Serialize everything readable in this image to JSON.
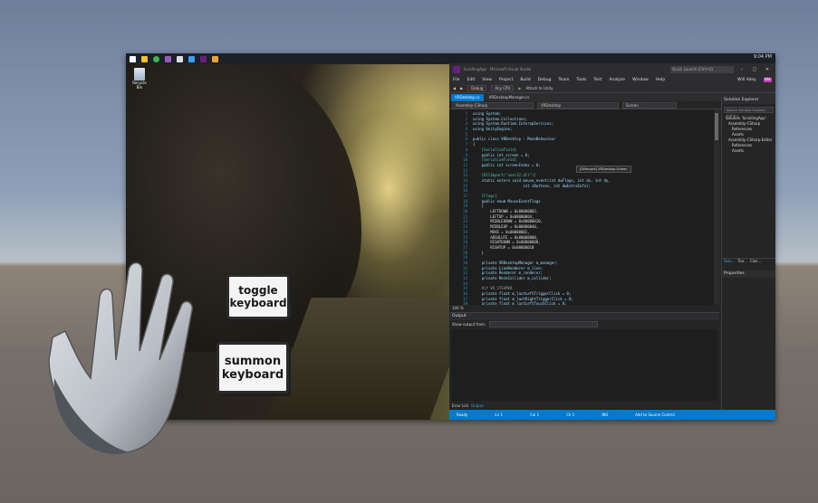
{
  "taskbar": {
    "clock": "9:04 PM",
    "icons": [
      "windows-start-icon",
      "file-explorer-icon",
      "chrome-icon",
      "app-icon",
      "terminal-icon",
      "onedrive-icon",
      "visual-studio-icon",
      "paint-icon"
    ]
  },
  "desktop": {
    "recycle_bin_label": "Recycle Bin"
  },
  "vs": {
    "title": "ScrollingApp - Microsoft Visual Studio",
    "search_placeholder": "Quick Launch (Ctrl+Q)",
    "user": "Will Ailey",
    "user_initials": "WA",
    "menu": [
      "File",
      "Edit",
      "View",
      "Project",
      "Build",
      "Debug",
      "Team",
      "Tools",
      "Test",
      "Analyze",
      "Window",
      "Help"
    ],
    "toolbar": {
      "config": "Debug",
      "platform": "Any CPU",
      "attach": "Attach to Unity"
    },
    "tabs": [
      {
        "label": "VRDesktop.cs",
        "active": true
      },
      {
        "label": "VRDesktopManager.cs",
        "active": false
      }
    ],
    "nav": {
      "project": "Assembly-CSharp",
      "class": "VRDesktop",
      "member": "Screen"
    },
    "line_numbers": [
      "1",
      "2",
      "3",
      "4",
      "5",
      "6",
      "7",
      "8",
      "9",
      "10",
      "11",
      "12",
      "13",
      "14",
      "15",
      "16",
      "17",
      "18",
      "19",
      "20",
      "21",
      "22",
      "23",
      "24",
      "25",
      "26",
      "27",
      "28",
      "29",
      "30",
      "31",
      "32",
      "33",
      "34",
      "35",
      "36",
      "37",
      "38",
      "39",
      "40",
      "41",
      "42",
      "43"
    ],
    "code_lines": [
      "using System;",
      "using System.Collections;",
      "using System.Runtime.InteropServices;",
      "using UnityEngine;",
      "",
      "public class VRDesktop : MonoBehaviour",
      "{",
      "    [SerializeField]",
      "    public int screen = 0;",
      "    [SerializeField]",
      "    public int screenIndex = 0;",
      "",
      "    [DllImport(\"user32.dll\")]",
      "    static extern void mouse_event(int dwFlags, int dx, int dy,",
      "                       int cButtons, int dwExtraInfo);",
      "",
      "    [Flags]",
      "    public enum MouseEventFlags",
      "    {",
      "        LEFTDOWN = 0x00000002,",
      "        LEFTUP = 0x00000004,",
      "        MIDDLEDOWN = 0x00000020,",
      "        MIDDLEUP = 0x00000040,",
      "        MOVE = 0x00000001,",
      "        ABSOLUTE = 0x00008000,",
      "        RIGHTDOWN = 0x00000008,",
      "        RIGHTUP = 0x00000010",
      "    }",
      "",
      "    private VRDesktopManager m_manager;",
      "    private LineRenderer m_line;",
      "    private Renderer m_renderer;",
      "    private MeshCollider m_collider;",
      "",
      "    #if VR_STEAMVR",
      "    private float m_lastLeftTriggerClick = 0;",
      "    private float m_lastRightTriggerClick = 0;",
      "    private float m_lastLeftTouchClick = 0;",
      "    private float m_distanceBeforeClick = 0;",
      "    private float m_lastDoubleClick = 0;",
      "    private bool m_controllerAttach;",
      "    #endif",
      ""
    ],
    "tooltip": "[DllImport] VRDesktop.Screen",
    "zoom": "100 %",
    "output": {
      "title": "Output",
      "show_from_label": "Show output from:",
      "tabs": [
        "Error List",
        "Output"
      ]
    },
    "solution": {
      "title": "Solution Explorer",
      "search_placeholder": "Search Solution Explorer (Ctrl+;)",
      "items": [
        "Solution 'ScrollingApp'",
        "Assembly-CSharp",
        "References",
        "Assets",
        "Assembly-CSharp-Editor",
        "References",
        "Assets"
      ],
      "tabs": [
        "Solu...",
        "Tea...",
        "Clas..."
      ],
      "properties_title": "Properties"
    },
    "status": {
      "ready": "Ready",
      "ln": "Ln 1",
      "col": "Col 1",
      "ch": "Ch 1",
      "ins": "INS",
      "source_control": "Add to Source Control"
    }
  },
  "vr_buttons": {
    "toggle": "toggle\nkeyboard",
    "summon": "summon\nkeyboard"
  }
}
